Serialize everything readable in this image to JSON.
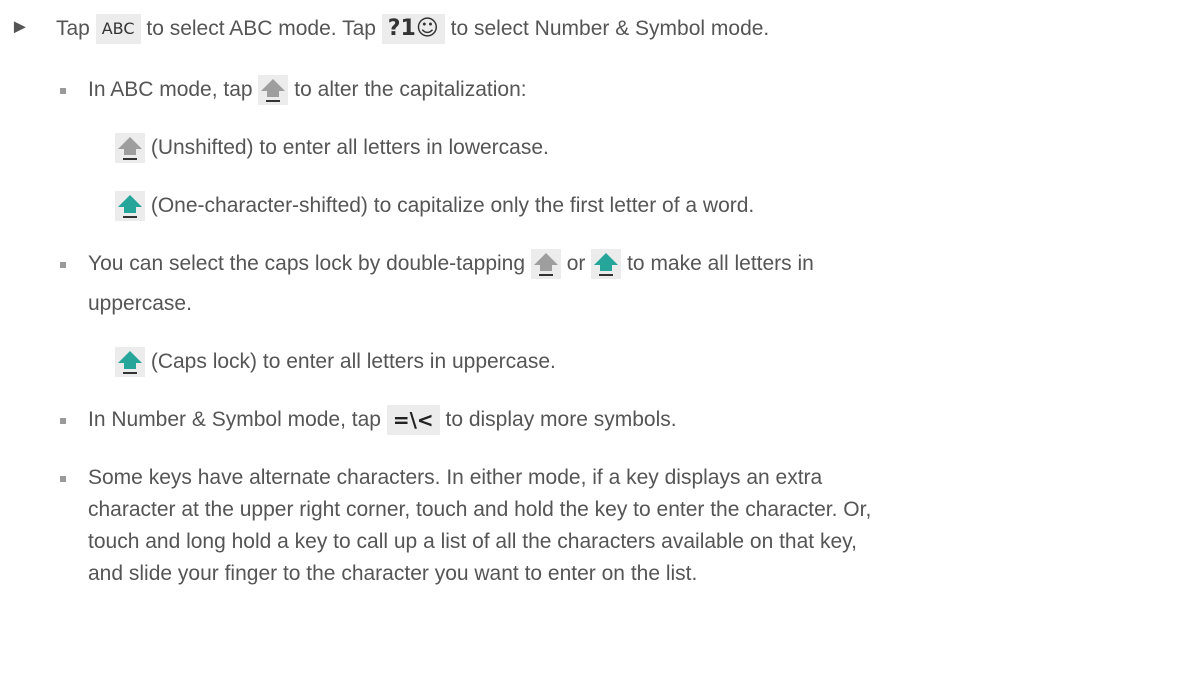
{
  "line1": {
    "arrow": "►",
    "part1": "Tap",
    "key_abc": "ABC",
    "part2": "to select ABC mode. Tap",
    "key_sym": "?1☺",
    "part3": "to select Number & Symbol mode."
  },
  "bullet1": {
    "part1": "In ABC mode, tap",
    "part2": "to alter the capitalization:"
  },
  "sub1": {
    "text": "(Unshifted) to enter all letters in lowercase."
  },
  "sub2": {
    "text": "(One-character-shifted) to capitalize only the first letter of a word."
  },
  "bullet2": {
    "part1": "You can select the caps lock by double-tapping",
    "or": "or",
    "part2": "to make all letters in",
    "line2": "uppercase."
  },
  "sub3": {
    "text": "(Caps lock) to enter all letters in uppercase."
  },
  "bullet3": {
    "part1": "In Number & Symbol mode, tap",
    "key_more": "=\\<",
    "part2": "to display more symbols."
  },
  "bullet4": {
    "lines": [
      "Some keys have alternate characters. In either mode, if a key displays an extra",
      "character at the upper right corner, touch and hold the key to enter the character. Or,",
      "touch and long hold a key to call up a list of all the characters available on that key,",
      "and slide your finger to the character you want to enter on the list."
    ]
  },
  "colors": {
    "text": "#555555",
    "key_background": "#ececec",
    "shift_gray": "#9e9e9e",
    "shift_teal": "#26a69a",
    "underline": "#333333"
  },
  "icons": {
    "unshifted": "shift-arrow-gray-icon",
    "shifted": "shift-arrow-teal-icon"
  }
}
